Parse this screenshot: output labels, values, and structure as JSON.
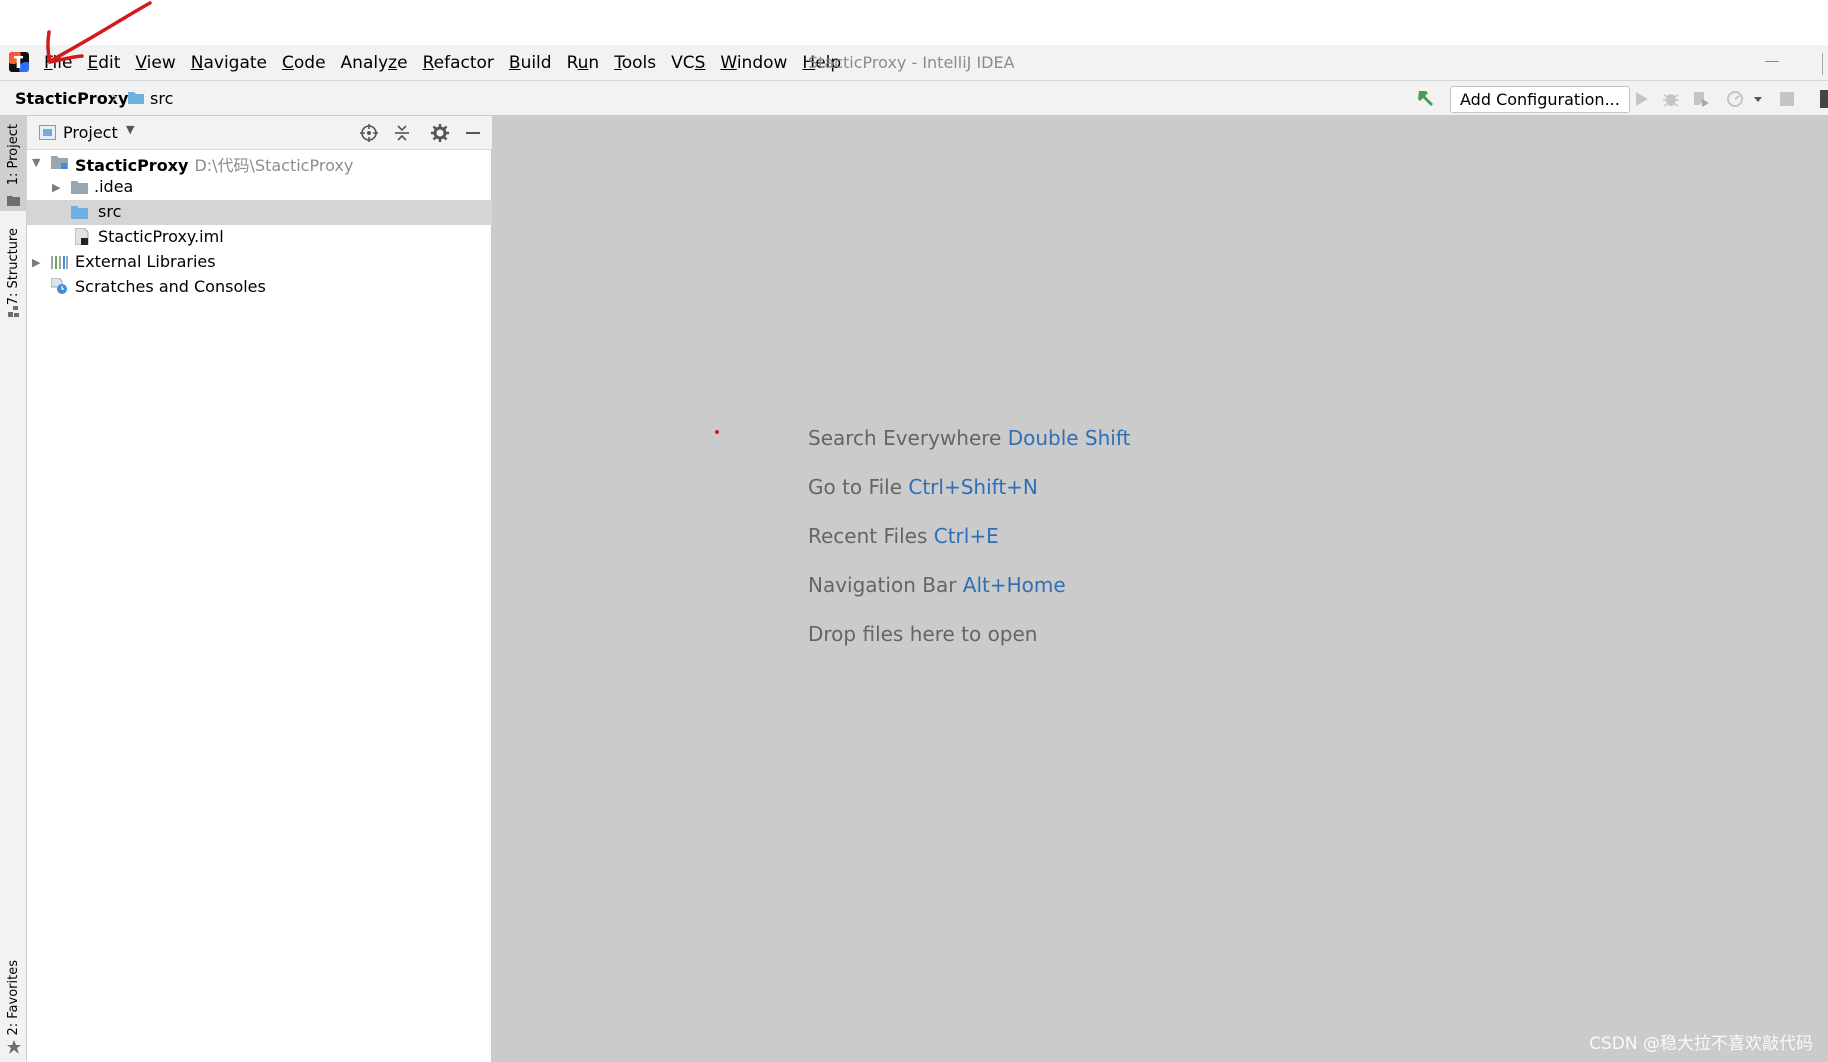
{
  "menubar": {
    "items": [
      {
        "pre": "",
        "ul": "F",
        "post": "ile"
      },
      {
        "pre": "",
        "ul": "E",
        "post": "dit"
      },
      {
        "pre": "",
        "ul": "V",
        "post": "iew"
      },
      {
        "pre": "",
        "ul": "N",
        "post": "avigate"
      },
      {
        "pre": "",
        "ul": "C",
        "post": "ode"
      },
      {
        "pre": "Analy",
        "ul": "z",
        "post": "e"
      },
      {
        "pre": "",
        "ul": "R",
        "post": "efactor"
      },
      {
        "pre": "",
        "ul": "B",
        "post": "uild"
      },
      {
        "pre": "R",
        "ul": "u",
        "post": "n"
      },
      {
        "pre": "",
        "ul": "T",
        "post": "ools"
      },
      {
        "pre": "VC",
        "ul": "S",
        "post": ""
      },
      {
        "pre": "",
        "ul": "W",
        "post": "indow"
      },
      {
        "pre": "",
        "ul": "H",
        "post": "elp"
      }
    ],
    "window_title": "StacticProxy - IntelliJ IDEA"
  },
  "navbar": {
    "project": "StacticProxy",
    "folder": "src",
    "add_configuration": "Add Configuration..."
  },
  "left_stripe": {
    "project_tab": "1: Project",
    "structure_tab": "7: Structure",
    "favorites_tab": "2: Favorites"
  },
  "project_panel": {
    "title": "Project",
    "tree": {
      "root_name": "StacticProxy",
      "root_path": "D:\\代码\\StacticProxy",
      "idea": ".idea",
      "src": "src",
      "iml": "StacticProxy.iml",
      "external": "External Libraries",
      "scratches": "Scratches and Consoles"
    }
  },
  "editor": {
    "hints": [
      {
        "text": "Search Everywhere ",
        "shortcut": "Double Shift"
      },
      {
        "text": "Go to File ",
        "shortcut": "Ctrl+Shift+N"
      },
      {
        "text": "Recent Files ",
        "shortcut": "Ctrl+E"
      },
      {
        "text": "Navigation Bar ",
        "shortcut": "Alt+Home"
      },
      {
        "text": "Drop files here to open",
        "shortcut": ""
      }
    ],
    "watermark": "CSDN @稳大拉不喜欢敲代码"
  },
  "colors": {
    "accent_link": "#2f6fb5",
    "editor_bg": "#cbcbcb",
    "annotation_red": "#d41b1b"
  }
}
